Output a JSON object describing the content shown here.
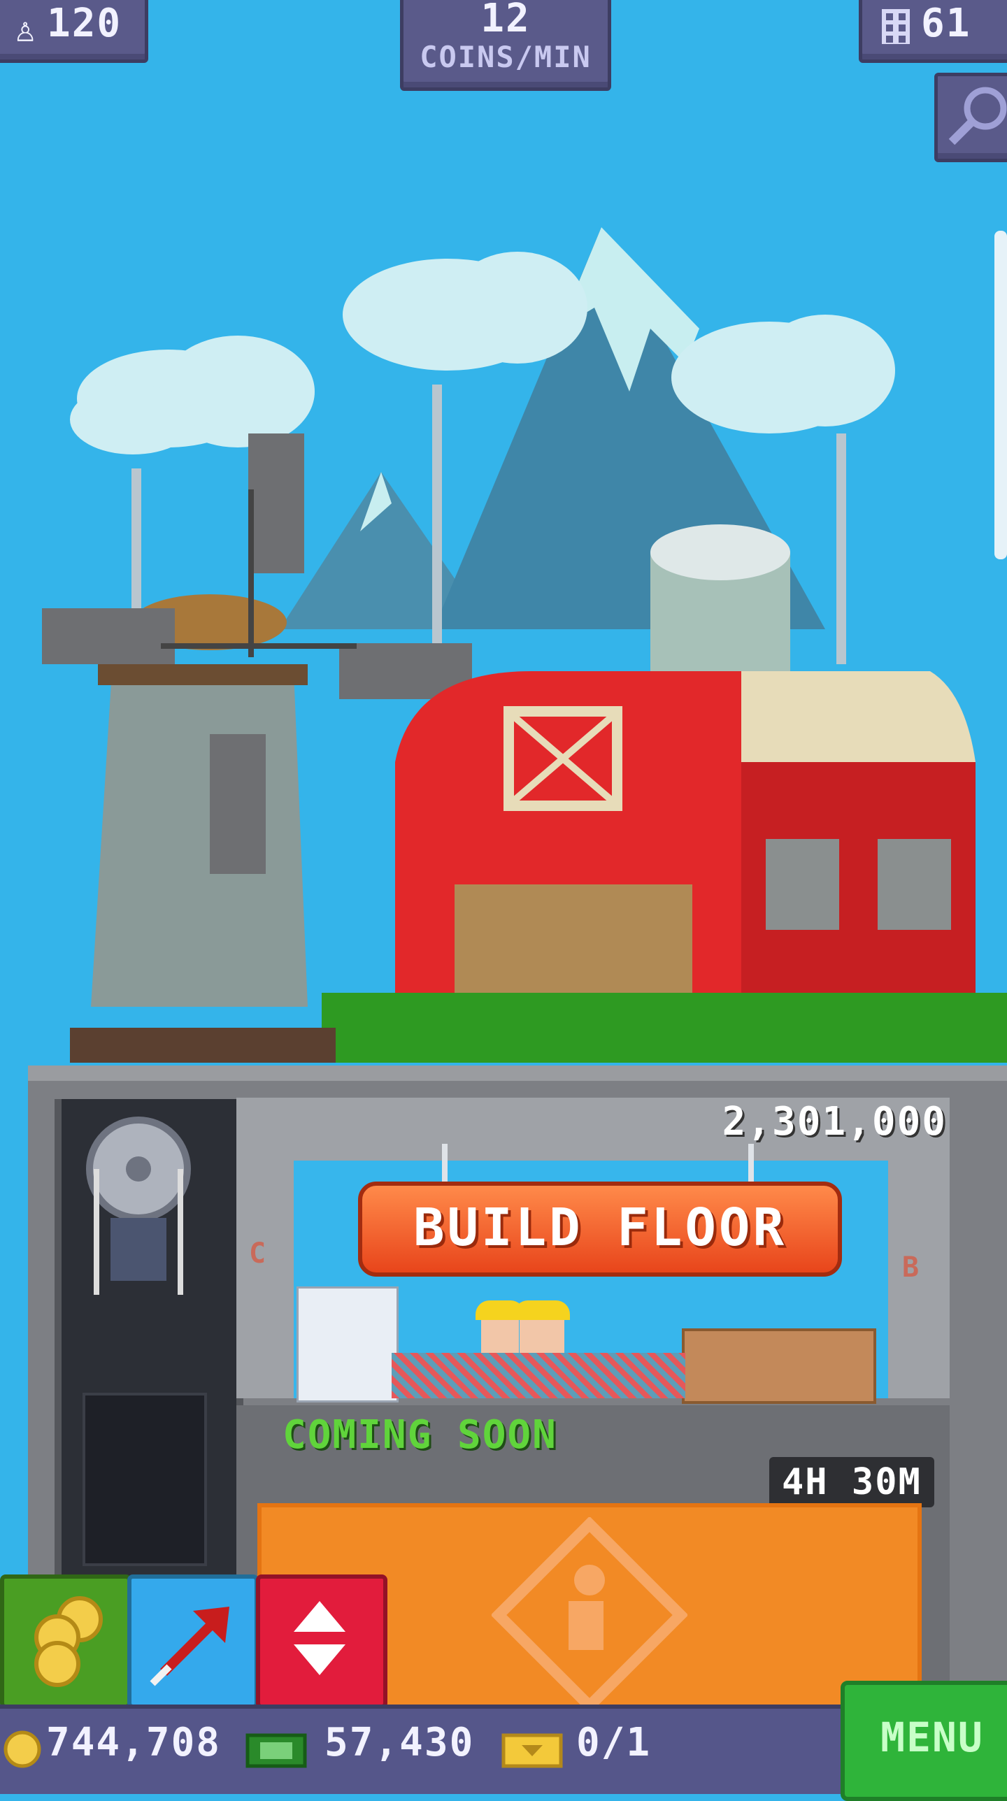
{
  "hud": {
    "population": "120",
    "coins_rate_value": "12",
    "coins_rate_unit": "COINS/MIN",
    "floors": "61"
  },
  "floor": {
    "cost": "2,301,000",
    "build_label": "BUILD FLOOR",
    "left_marker": "C",
    "right_marker": "B"
  },
  "construction": {
    "status": "COMING SOON",
    "timer": "4H 30M"
  },
  "bottom_bar": {
    "coins": "744,708",
    "bux": "57,430",
    "tickets": "0/1",
    "menu_label": "MENU"
  },
  "colors": {
    "sky": "#34b4ea",
    "build_button": "#e8451b",
    "coming_soon_text": "#60d43b",
    "menu_button": "#2fb43a"
  },
  "icons": [
    "person-icon",
    "building-icon",
    "magnifier-icon",
    "coins-icon",
    "raffle-arrow-icon",
    "elevator-arrows-icon",
    "bux-icon",
    "ticket-icon"
  ]
}
